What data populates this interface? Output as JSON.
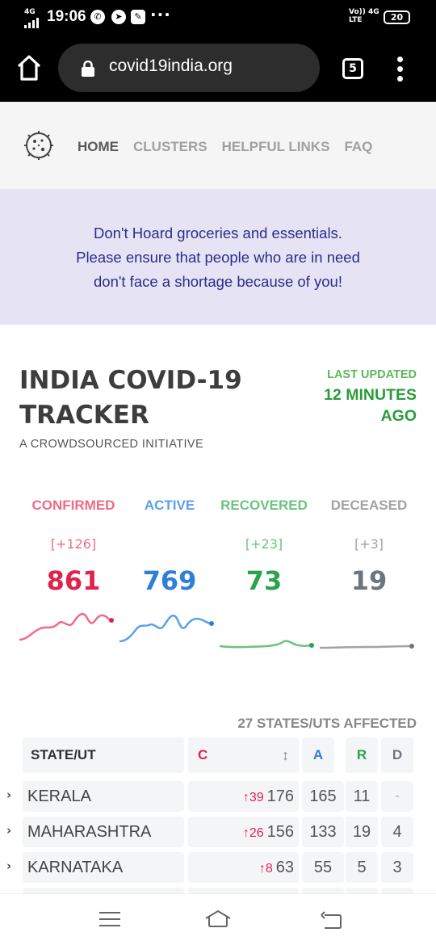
{
  "status_bar": {
    "network_type": "4G",
    "time": "19:06",
    "app_icons": [
      "whatsapp-icon",
      "compass-icon",
      "edit-app-icon"
    ],
    "more_indicator": "···",
    "volte_text": "Vo)) 4G",
    "volte_sub": "LTE",
    "battery": "20"
  },
  "browser": {
    "url": "covid19india.org",
    "tab_count": "5"
  },
  "nav": {
    "links": [
      {
        "label": "HOME",
        "active": true
      },
      {
        "label": "CLUSTERS",
        "active": false
      },
      {
        "label": "HELPFUL LINKS",
        "active": false
      },
      {
        "label": "FAQ",
        "active": false
      }
    ]
  },
  "banner": {
    "lines": [
      "Don't Hoard groceries and essentials.",
      "Please ensure that people who are in need",
      "don't face a shortage because of you!"
    ]
  },
  "header": {
    "title_line1": "INDIA COVID-19",
    "title_line2": "TRACKER",
    "subtitle": "A CROWDSOURCED INITIATIVE",
    "last_updated_label": "LAST UPDATED",
    "last_updated_line1": "12 MINUTES",
    "last_updated_line2": "AGO"
  },
  "stats": [
    {
      "label": "CONFIRMED",
      "delta": "[+126]",
      "value": "861",
      "color": "#e0234e"
    },
    {
      "label": "ACTIVE",
      "delta": "",
      "value": "769",
      "color": "#2f7fd8"
    },
    {
      "label": "RECOVERED",
      "delta": "[+23]",
      "value": "73",
      "color": "#2aa34a"
    },
    {
      "label": "DECEASED",
      "delta": "[+3]",
      "value": "19",
      "color": "#6c757d"
    }
  ],
  "affected_text": "27 STATES/UTS AFFECTED",
  "table": {
    "headers": {
      "state": "STATE/UT",
      "c": "C",
      "a": "A",
      "r": "R",
      "d": "D"
    },
    "sort_icon": "sort-icon",
    "rows": [
      {
        "state": "KERALA",
        "delta": "↑39",
        "c": "176",
        "a": "165",
        "r": "11",
        "d": "-"
      },
      {
        "state": "MAHARASHTRA",
        "delta": "↑26",
        "c": "156",
        "a": "133",
        "r": "19",
        "d": "4"
      },
      {
        "state": "KARNATAKA",
        "delta": "↑8",
        "c": "63",
        "a": "55",
        "r": "5",
        "d": "3"
      }
    ]
  },
  "colors": {
    "confirmed": "#e0234e",
    "active": "#2f7fd8",
    "recovered": "#2aa34a",
    "deceased": "#6c757d",
    "banner_bg": "#e6e4f4",
    "banner_text": "#2c2c8c"
  }
}
